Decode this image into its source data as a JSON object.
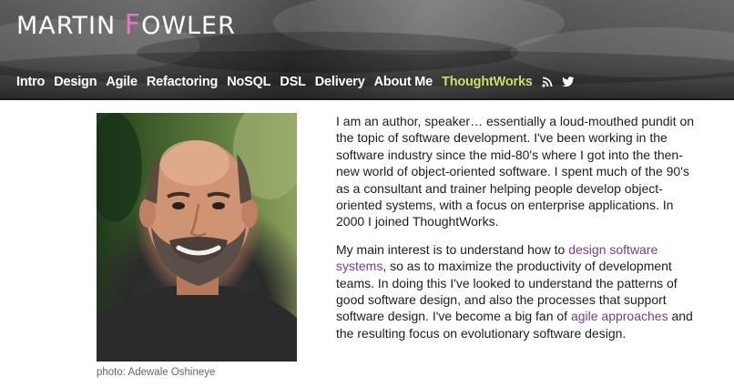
{
  "site": {
    "logo": {
      "first": "MARTIN ",
      "accent_letter": "F",
      "rest": "OWLER"
    }
  },
  "nav": {
    "items": [
      "Intro",
      "Design",
      "Agile",
      "Refactoring",
      "NoSQL",
      "DSL",
      "Delivery",
      "About Me"
    ],
    "highlight": "ThoughtWorks",
    "icons": [
      "rss-icon",
      "twitter-icon"
    ]
  },
  "photo": {
    "caption": "photo: Adewale Oshineye"
  },
  "bio": {
    "p1": "I am an author, speaker… essentially a loud-mouthed pundit on the topic of software development. I've been working in the software industry since the mid-80's where I got into the then-new world of object-oriented software. I spent much of the 90's as a consultant and trainer helping people develop object-oriented systems, with a focus on enterprise applications. In 2000 I joined ThoughtWorks.",
    "p2_a": "My main interest is to understand how to ",
    "p2_link1": "design software systems",
    "p2_b": ", so as to maximize the productivity of development teams. In doing this I've looked to understand the patterns of good software design, and also the processes that support software design. I've become a big fan of ",
    "p2_link2": "agile approaches",
    "p2_c": " and the resulting focus on evolutionary software design."
  },
  "colors": {
    "accent_pink": "#e477c8",
    "nav_highlight": "#c7e26a",
    "link": "#7b3b8a"
  }
}
